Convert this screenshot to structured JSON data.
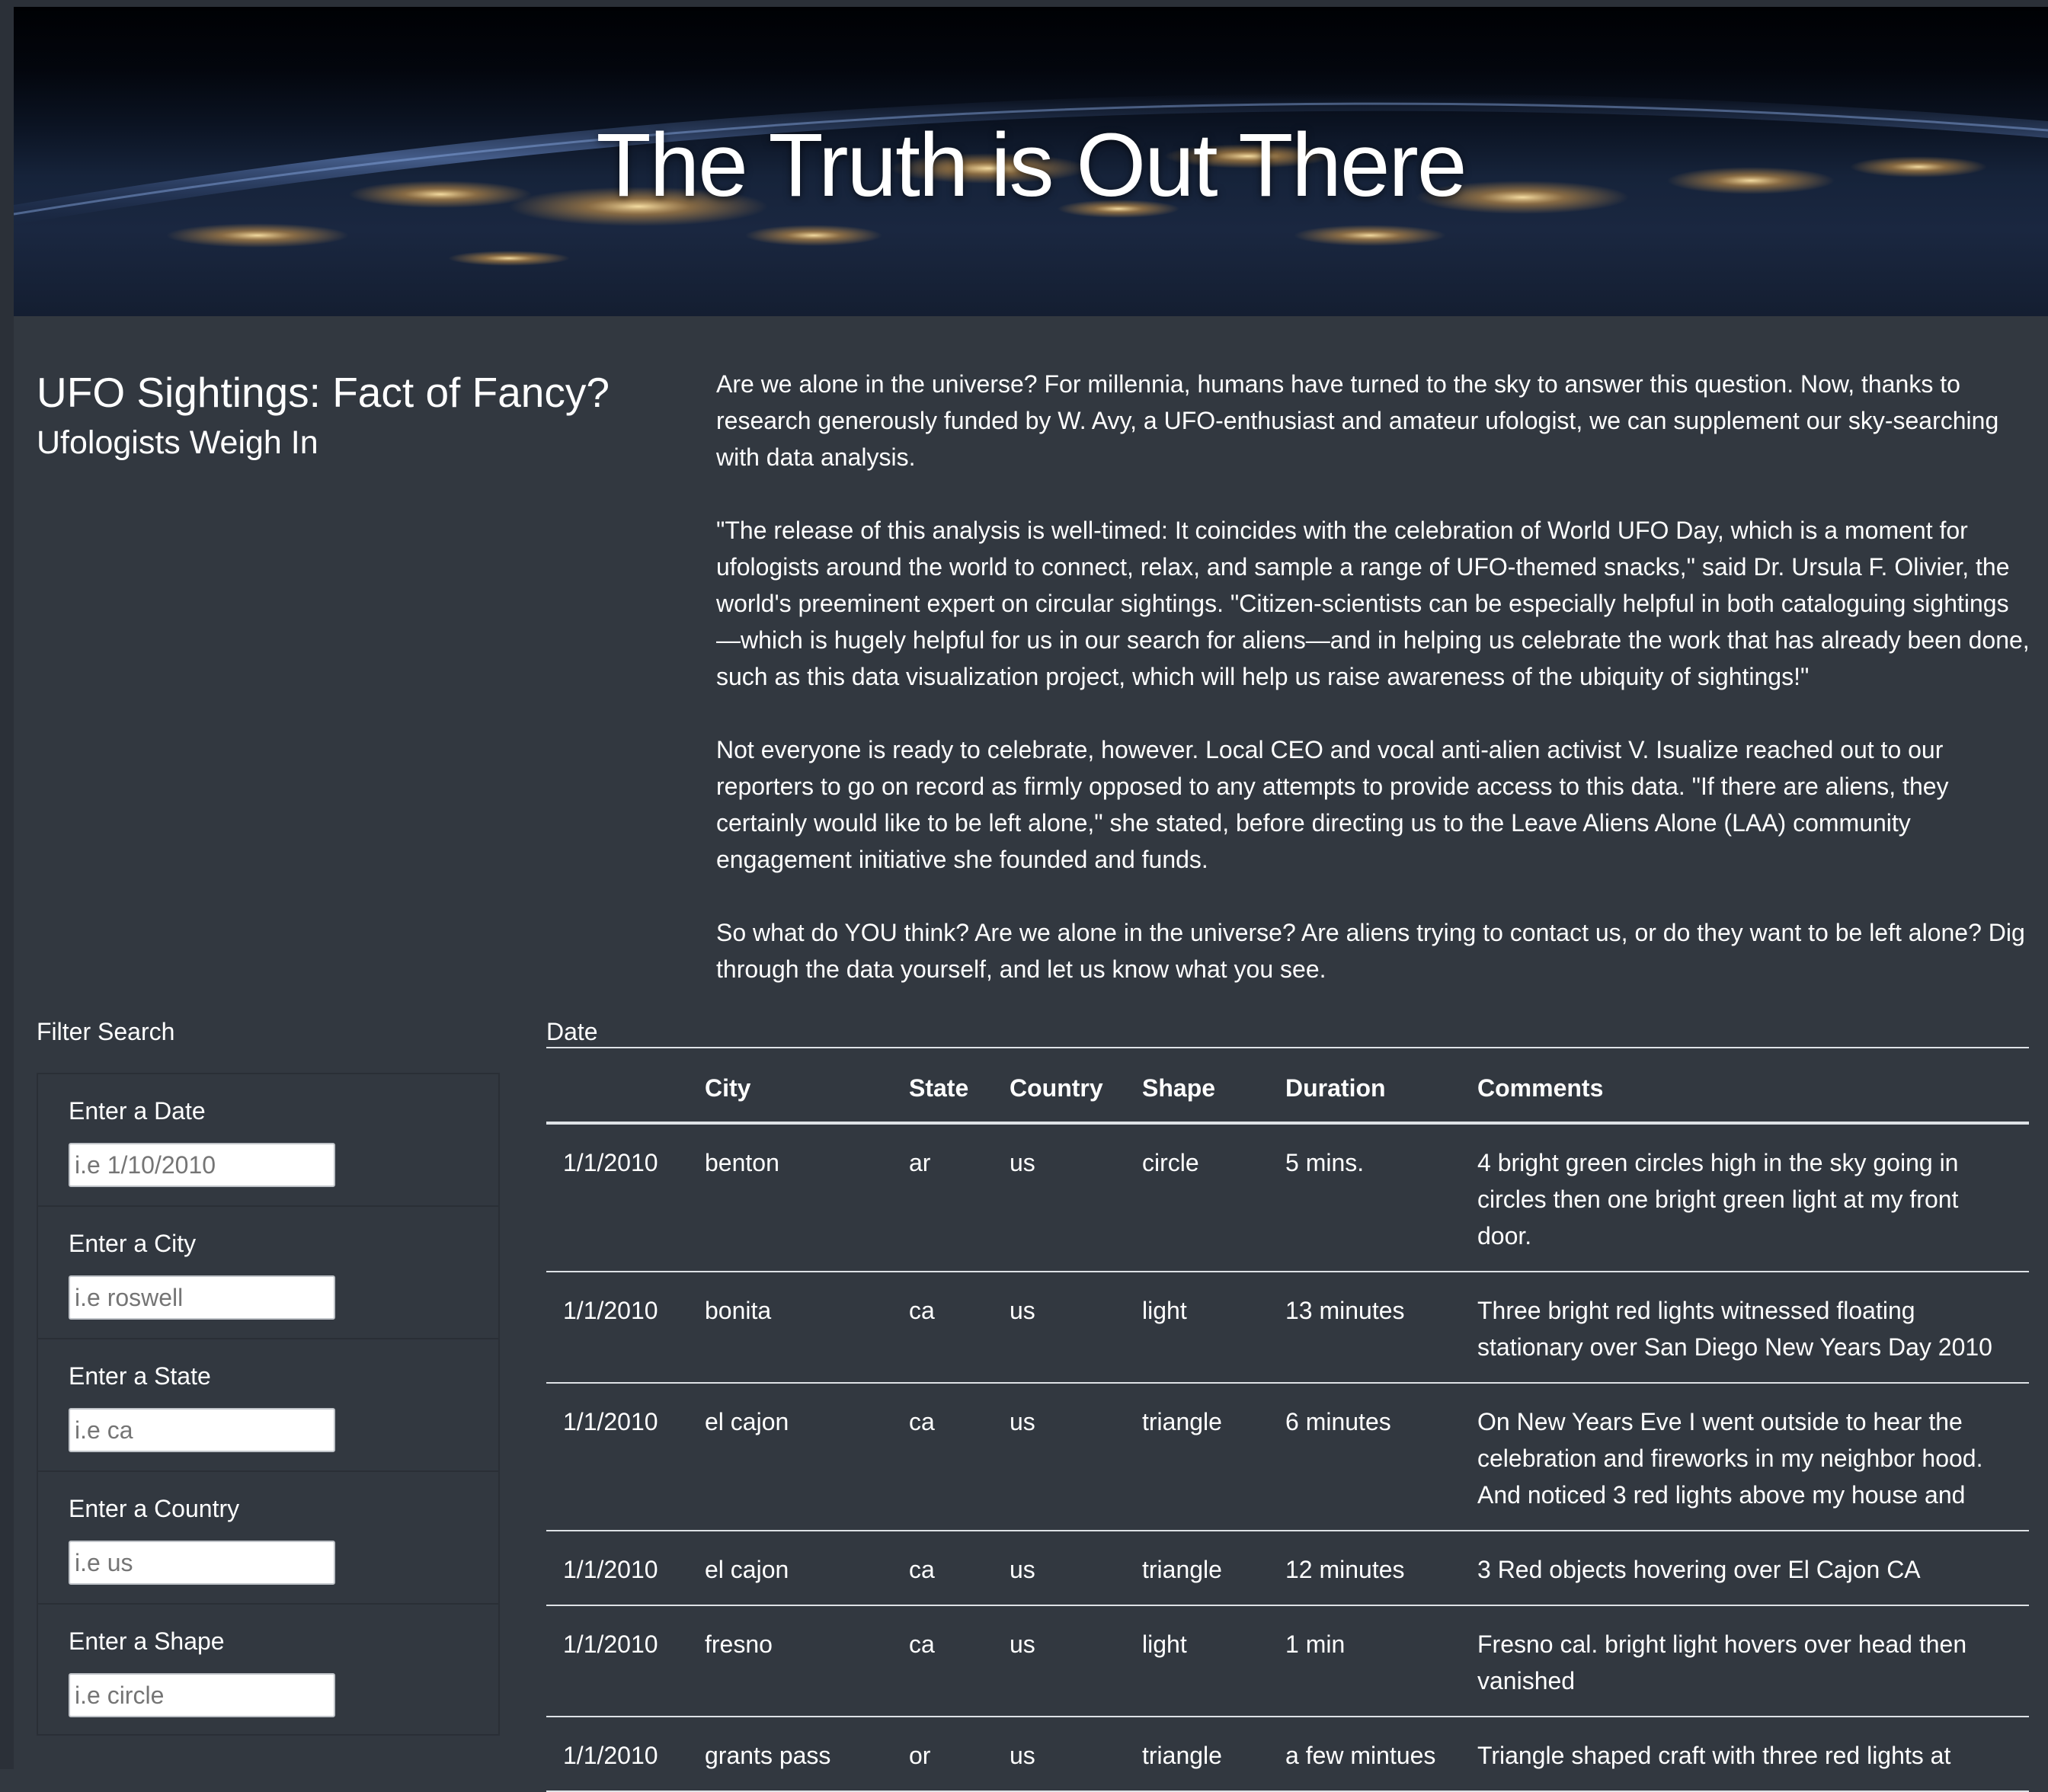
{
  "hero": {
    "title": "The Truth is Out There"
  },
  "headline": {
    "title": "UFO Sightings: Fact of Fancy?",
    "subtitle": "Ufologists Weigh In"
  },
  "article": {
    "paragraphs": [
      "Are we alone in the universe? For millennia, humans have turned to the sky to answer this question. Now, thanks to research generously funded by W. Avy, a UFO-enthusiast and amateur ufologist, we can supplement our sky-searching with data analysis.",
      "\"The release of this analysis is well-timed: It coincides with the celebration of World UFO Day, which is a moment for ufologists around the world to connect, relax, and sample a range of UFO-themed snacks,\" said Dr. Ursula F. Olivier, the world's preeminent expert on circular sightings. \"Citizen-scientists can be especially helpful in both cataloguing sightings—which is hugely helpful for us in our search for aliens—and in helping us celebrate the work that has already been done, such as this data visualization project, which will help us raise awareness of the ubiquity of sightings!\"",
      "Not everyone is ready to celebrate, however. Local CEO and vocal anti-alien activist V. Isualize reached out to our reporters to go on record as firmly opposed to any attempts to provide access to this data. \"If there are aliens, they certainly would like to be left alone,\" she stated, before directing us to the Leave Aliens Alone (LAA) community engagement initiative she founded and funds.",
      "So what do YOU think? Are we alone in the universe? Are aliens trying to contact us, or do they want to be left alone? Dig through the data yourself, and let us know what you see."
    ]
  },
  "filters": {
    "title": "Filter Search",
    "items": [
      {
        "label": "Enter a Date",
        "placeholder": "i.e 1/10/2010",
        "value": ""
      },
      {
        "label": "Enter a City",
        "placeholder": "i.e roswell",
        "value": ""
      },
      {
        "label": "Enter a State",
        "placeholder": "i.e ca",
        "value": ""
      },
      {
        "label": "Enter a Country",
        "placeholder": "i.e us",
        "value": ""
      },
      {
        "label": "Enter a Shape",
        "placeholder": "i.e circle",
        "value": ""
      }
    ]
  },
  "table": {
    "caption": "Date",
    "headers": [
      "",
      "City",
      "State",
      "Country",
      "Shape",
      "Duration",
      "Comments"
    ],
    "rows": [
      [
        "1/1/2010",
        "benton",
        "ar",
        "us",
        "circle",
        "5 mins.",
        "4 bright green circles high in the sky going in circles then one bright green light at my front door."
      ],
      [
        "1/1/2010",
        "bonita",
        "ca",
        "us",
        "light",
        "13 minutes",
        "Three bright red lights witnessed floating stationary over San Diego New Years Day 2010"
      ],
      [
        "1/1/2010",
        "el cajon",
        "ca",
        "us",
        "triangle",
        "6 minutes",
        "On New Years Eve I went outside to hear the celebration and fireworks in my neighbor hood. And noticed 3 red lights above my house and"
      ],
      [
        "1/1/2010",
        "el cajon",
        "ca",
        "us",
        "triangle",
        "12 minutes",
        "3 Red objects hovering over El Cajon CA"
      ],
      [
        "1/1/2010",
        "fresno",
        "ca",
        "us",
        "light",
        "1 min",
        "Fresno cal. bright light hovers over head then vanished"
      ],
      [
        "1/1/2010",
        "grants pass",
        "or",
        "us",
        "triangle",
        "a few mintues",
        "Triangle shaped craft with three red lights at"
      ]
    ]
  }
}
